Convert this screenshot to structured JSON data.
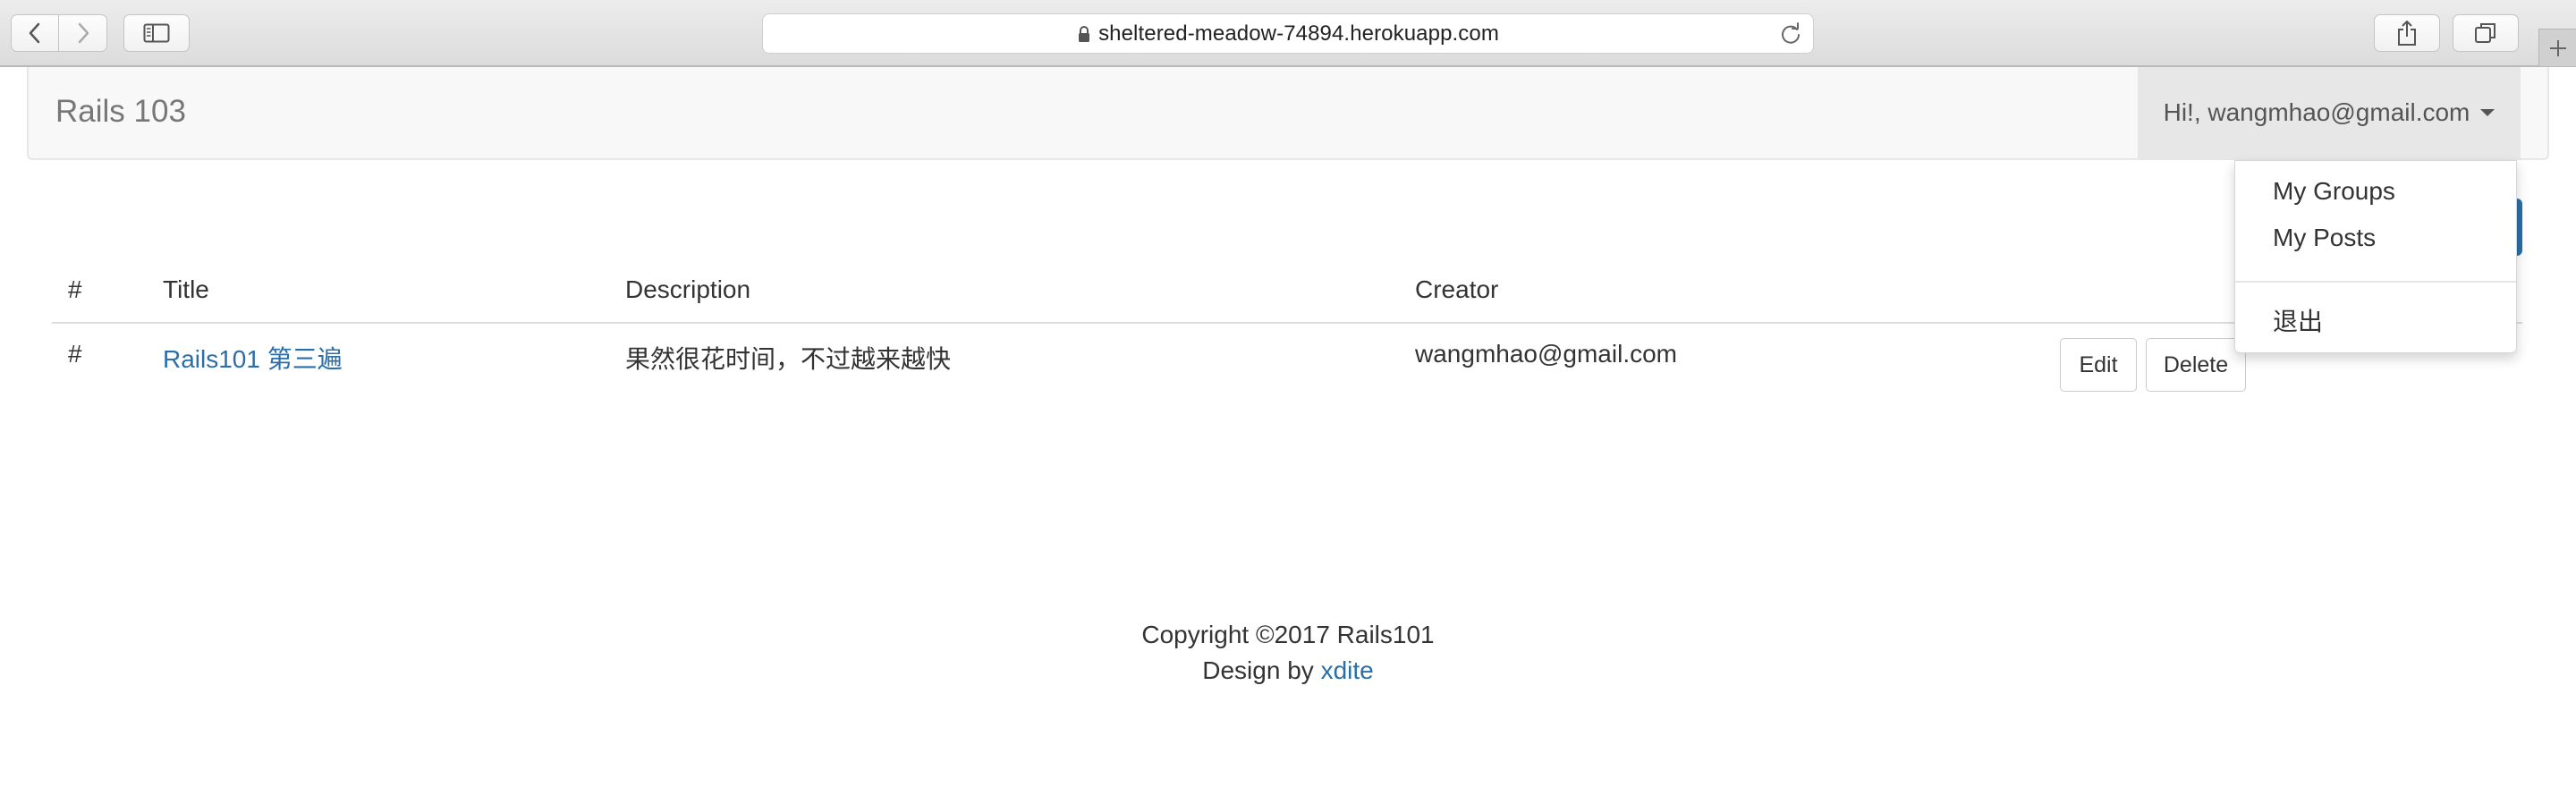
{
  "browser": {
    "url": "sheltered-meadow-74894.herokuapp.com"
  },
  "navbar": {
    "brand": "Rails 103",
    "user_menu_label": "Hi!, wangmhao@gmail.com"
  },
  "dropdown": {
    "items": [
      {
        "label": "My Groups"
      },
      {
        "label": "My Posts"
      },
      {
        "label": "退出"
      }
    ]
  },
  "table": {
    "headers": [
      "#",
      "Title",
      "Description",
      "Creator"
    ],
    "rows": [
      {
        "num": "#",
        "title": "Rails101 第三遍",
        "description": "果然很花时间，不过越来越快",
        "creator": "wangmhao@gmail.com",
        "edit_label": "Edit",
        "delete_label": "Delete"
      }
    ]
  },
  "footer": {
    "copyright": "Copyright ©2017 Rails101",
    "design_by": "Design by",
    "design_link": "xdite"
  },
  "colors": {
    "link": "#2a6fa8",
    "navbar_bg": "#f8f8f8",
    "user_menu_bg": "#e7e7e7"
  }
}
